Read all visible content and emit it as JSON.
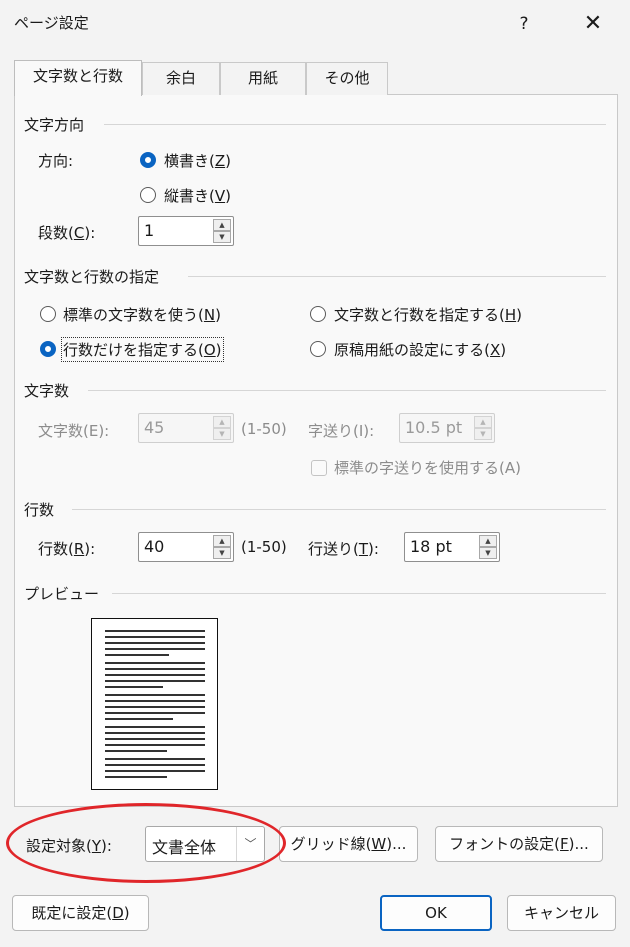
{
  "window": {
    "title": "ページ設定",
    "help": "?",
    "close": "✕"
  },
  "tabs": [
    {
      "label": "文字数と行数",
      "active": true
    },
    {
      "label": "余白"
    },
    {
      "label": "用紙"
    },
    {
      "label": "その他"
    }
  ],
  "direction": {
    "heading": "文字方向",
    "label": "方向:",
    "horizontal": {
      "text": "横書き(",
      "key": "Z",
      "end": ")"
    },
    "vertical": {
      "text": "縦書き(",
      "key": "V",
      "end": ")"
    },
    "columns_label": {
      "text": "段数(",
      "key": "C",
      "end": "):"
    },
    "columns_value": "1"
  },
  "spec": {
    "heading": "文字数と行数の指定",
    "opt_standard": {
      "text": "標準の文字数を使う(",
      "key": "N",
      "end": ")"
    },
    "opt_chars_lines": {
      "text": "文字数と行数を指定する(",
      "key": "H",
      "end": ")"
    },
    "opt_lines_only": {
      "text": "行数だけを指定する(",
      "key": "O",
      "end": ")"
    },
    "opt_manuscript": {
      "text": "原稿用紙の設定にする(",
      "key": "X",
      "end": ")"
    }
  },
  "chars": {
    "heading": "文字数",
    "count_label": "文字数(E):",
    "count_value": "45",
    "count_range": "(1-50)",
    "pitch_label": "字送り(I):",
    "pitch_value": "10.5 pt",
    "default_pitch": "標準の字送りを使用する(A)"
  },
  "lines": {
    "heading": "行数",
    "count_label": {
      "text": "行数(",
      "key": "R",
      "end": "):"
    },
    "count_value": "40",
    "count_range": "(1-50)",
    "pitch_label": {
      "text": "行送り(",
      "key": "T",
      "end": "):"
    },
    "pitch_value": "18 pt"
  },
  "preview": {
    "heading": "プレビュー"
  },
  "apply_to": {
    "label": {
      "text": "設定対象(",
      "key": "Y",
      "end": "):"
    },
    "value": "文書全体"
  },
  "buttons": {
    "grid": {
      "text": "グリッド線(",
      "key": "W",
      "end": ")..."
    },
    "font": {
      "text": "フォントの設定(",
      "key": "F",
      "end": ")..."
    },
    "default": {
      "text": "既定に設定(",
      "key": "D",
      "end": ")"
    },
    "ok": "OK",
    "cancel": "キャンセル"
  },
  "colors": {
    "accent": "#0a64c2",
    "highlight": "#e0262a"
  }
}
